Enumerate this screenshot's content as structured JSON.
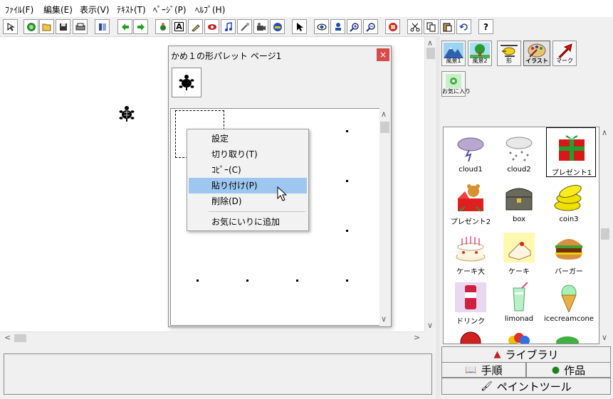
{
  "menu": [
    {
      "label": "ﾌｧｲﾙ(F)"
    },
    {
      "label": "編集(E)"
    },
    {
      "label": "表示(V)"
    },
    {
      "label": "ﾃｷｽﾄ(T)"
    },
    {
      "label": "ﾍﾟｰｼﾞ(P)"
    },
    {
      "label": "ﾍﾙﾌﾟ(H)"
    }
  ],
  "toolbar": {
    "help_label": "?",
    "text_tool_label": "A"
  },
  "palette": {
    "title": "かめ１の形パレット ページ1",
    "close_glyph": "×"
  },
  "context_menu": {
    "items": [
      {
        "label": "設定"
      },
      {
        "label": "切り取り(T)"
      },
      {
        "label": "ｺﾋﾟｰ(C)"
      },
      {
        "label": "貼り付け(P)"
      },
      {
        "label": "削除(D)"
      },
      {
        "label": "お気にいりに追加"
      }
    ],
    "highlighted": "貼り付け(P)"
  },
  "categories": [
    {
      "label": "風景1"
    },
    {
      "label": "風景2"
    },
    {
      "label": "形"
    },
    {
      "label": "イラスト"
    },
    {
      "label": "マーク"
    }
  ],
  "favorites": {
    "label": "お気に入り"
  },
  "library": {
    "selected": "プレゼント1",
    "items": [
      {
        "label": "cloud1"
      },
      {
        "label": "cloud2"
      },
      {
        "label": "プレゼント1"
      },
      {
        "label": "プレゼント2"
      },
      {
        "label": "box"
      },
      {
        "label": "coin3"
      },
      {
        "label": "ケーキ大"
      },
      {
        "label": "ケーキ"
      },
      {
        "label": "バーガー"
      },
      {
        "label": "ドリンク"
      },
      {
        "label": "limonad"
      },
      {
        "label": "icecreamcone"
      }
    ]
  },
  "bottom_tabs": {
    "library": "ライブラリ",
    "steps": "手順",
    "works": "作品",
    "paint": "ペイントツール"
  },
  "colors": {
    "highlight": "#9ec7f0",
    "close": "#d84b4b"
  }
}
